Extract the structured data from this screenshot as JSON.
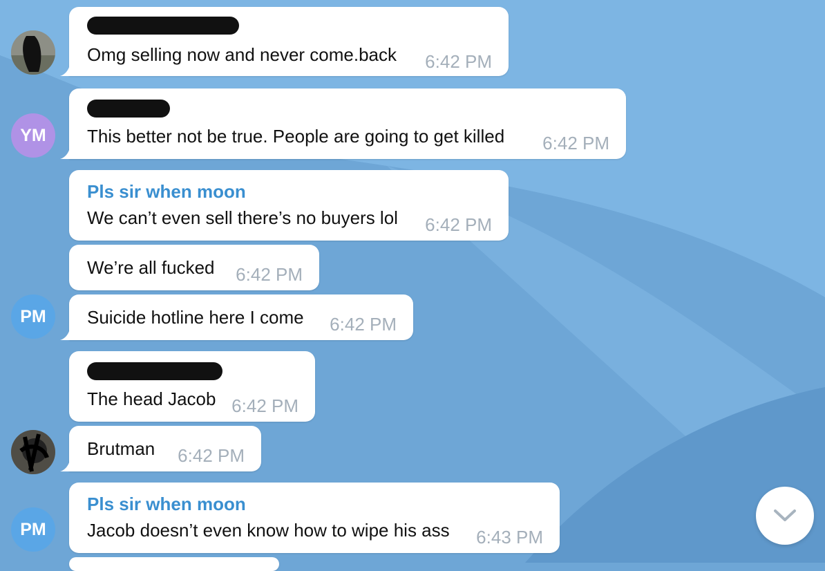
{
  "colors": {
    "background": "#6ea6d6",
    "sender_blue": "#3a8fd0",
    "timestamp": "#a4afba",
    "avatar_ym": "#b092e6",
    "avatar_pm": "#5aa6e6"
  },
  "messages": [
    {
      "text": "Omg selling now and never come.back",
      "time": "6:42 PM",
      "sender_redacted": true
    },
    {
      "text": "This better not be true. People are going to get killed",
      "time": "6:42 PM",
      "sender_redacted": true
    },
    {
      "sender": "Pls sir when moon",
      "text": "We can’t even sell there’s no buyers lol",
      "time": "6:42 PM"
    },
    {
      "text": "We’re all fucked",
      "time": "6:42 PM"
    },
    {
      "text": "Suicide hotline here I come",
      "time": "6:42 PM"
    },
    {
      "text": "The head Jacob",
      "time": "6:42 PM",
      "sender_redacted": true
    },
    {
      "text": "Brutman",
      "time": "6:42 PM"
    },
    {
      "sender": "Pls sir when moon",
      "text": "Jacob doesn’t even know how to wipe his ass",
      "time": "6:43 PM"
    }
  ],
  "avatars": {
    "ym": "YM",
    "pm": "PM",
    "photo_icon": "user-photo",
    "redacted_photo_icon": "redacted-user-photo"
  },
  "scroll_button": {
    "icon": "chevron-down-icon"
  }
}
